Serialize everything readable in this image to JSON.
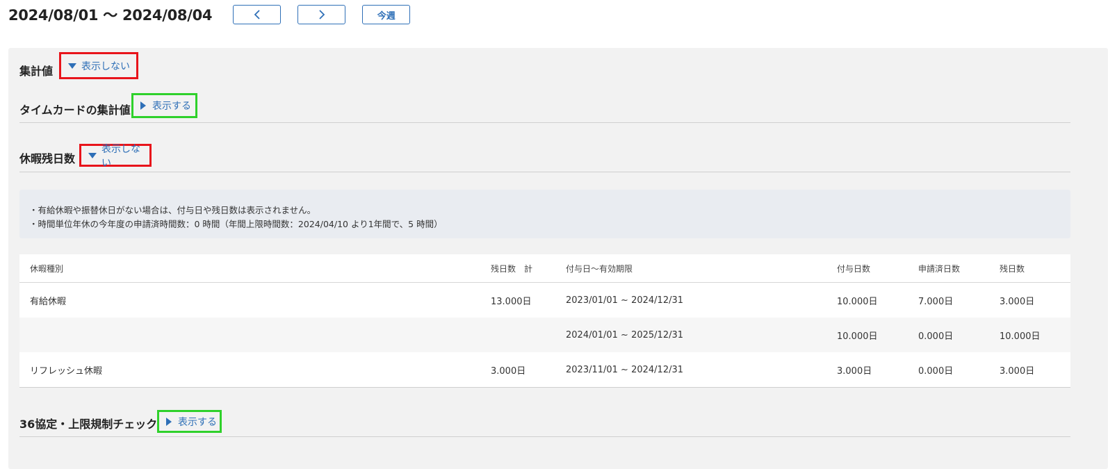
{
  "header": {
    "date_range": "2024/08/01 〜 2024/08/04",
    "prev_icon": "chevron-left-icon",
    "next_icon": "chevron-right-icon",
    "this_week_label": "今週"
  },
  "sections": {
    "summary": {
      "title": "集計値",
      "toggle_label": "表示しない",
      "toggle_icon": "triangle-down-icon"
    },
    "timecard": {
      "title": "タイムカードの集計値",
      "toggle_label": "表示する",
      "toggle_icon": "triangle-right-icon"
    },
    "leave": {
      "title": "休暇残日数",
      "toggle_label": "表示しない",
      "toggle_icon": "triangle-down-icon"
    },
    "agreement": {
      "title": "36協定・上限規制チェック",
      "toggle_label": "表示する",
      "toggle_icon": "triangle-right-icon"
    }
  },
  "notice": {
    "lines": [
      "・有給休暇や振替休日がない場合は、付与日や残日数は表示されません。",
      "・時間単位年休の今年度の申請済時間数：0 時間（年間上限時間数：2024/04/10 より1年間で、5 時間）"
    ]
  },
  "leave_table": {
    "headers": [
      "休暇種別",
      "残日数　計",
      "付与日〜有効期限",
      "付与日数",
      "申請済日数",
      "残日数"
    ],
    "rows": [
      [
        "有給休暇",
        "13.000日",
        "2023/01/01 ~ 2024/12/31",
        "10.000日",
        "7.000日",
        "3.000日"
      ],
      [
        "",
        "",
        "2024/01/01 ~ 2025/12/31",
        "10.000日",
        "0.000日",
        "10.000日"
      ],
      [
        "リフレッシュ休暇",
        "3.000日",
        "2023/11/01 ~ 2024/12/31",
        "3.000日",
        "0.000日",
        "3.000日"
      ]
    ]
  },
  "colors": {
    "accent": "#2e6fb7",
    "highlight_red": "#e8141b",
    "highlight_green": "#2fd12b",
    "panel_bg": "#f2f2f2"
  }
}
